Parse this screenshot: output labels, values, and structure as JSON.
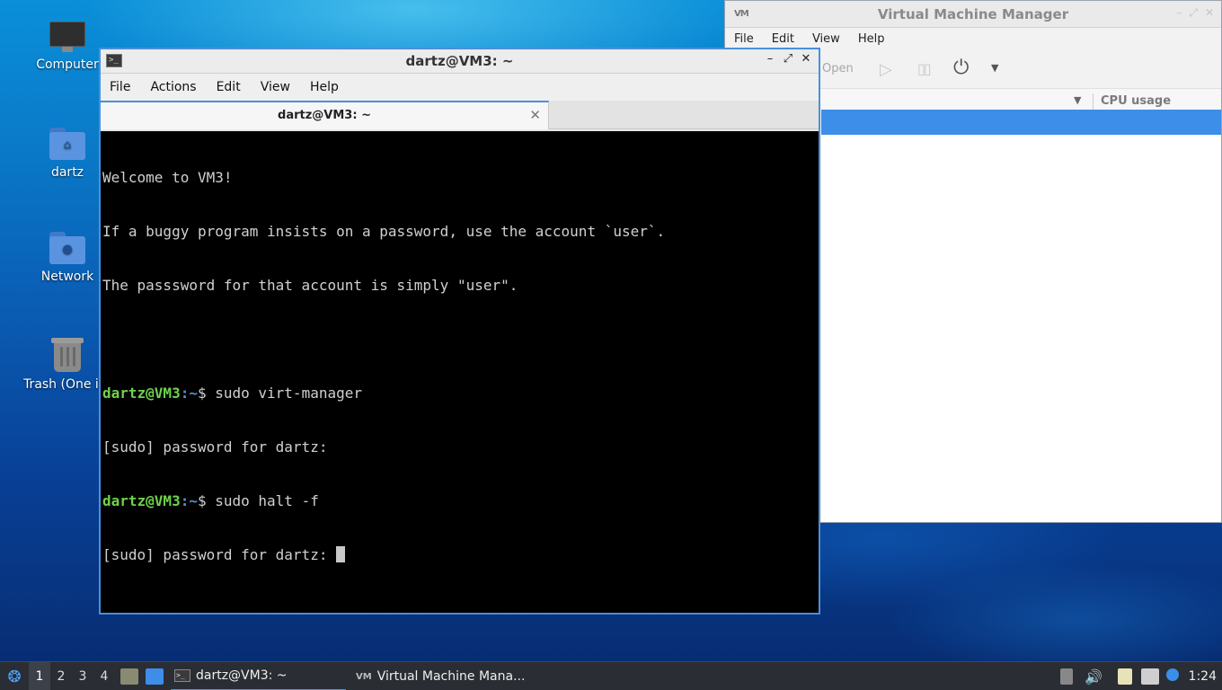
{
  "desktop": {
    "icons": [
      {
        "label": "Computer",
        "icon": "computer-icon"
      },
      {
        "label": "dartz",
        "icon": "home-folder-icon"
      },
      {
        "label": "Network",
        "icon": "network-folder-icon"
      },
      {
        "label": "Trash (One ite",
        "icon": "trash-icon"
      }
    ]
  },
  "vmm": {
    "title": "Virtual Machine Manager",
    "logo": "VM",
    "menu": [
      "File",
      "Edit",
      "View",
      "Help"
    ],
    "toolbar": {
      "open_label": "Open"
    },
    "columns": {
      "cpu_label": "CPU usage"
    }
  },
  "terminal": {
    "title": "dartz@VM3: ~",
    "menu": [
      "File",
      "Actions",
      "Edit",
      "View",
      "Help"
    ],
    "tab_label": "dartz@VM3: ~",
    "lines": [
      "Welcome to VM3!",
      "If a buggy program insists on a password, use the account `user`.",
      "The passsword for that account is simply \"user\".",
      "",
      "$ sudo virt-manager",
      "[sudo] password for dartz:",
      "$ sudo halt -f",
      "[sudo] password for dartz: "
    ],
    "prompt_user": "dartz@VM3",
    "prompt_path": ":~"
  },
  "taskbar": {
    "workspaces": [
      "1",
      "2",
      "3",
      "4"
    ],
    "active_workspace": "1",
    "tasks": [
      {
        "label": "dartz@VM3: ~",
        "active": true
      },
      {
        "label": "Virtual Machine Mana...",
        "active": false
      }
    ],
    "clock": "1:24"
  },
  "colors": {
    "accent": "#4a90d9",
    "selection": "#3d8ee8",
    "prompt_green": "#6fd24a"
  }
}
